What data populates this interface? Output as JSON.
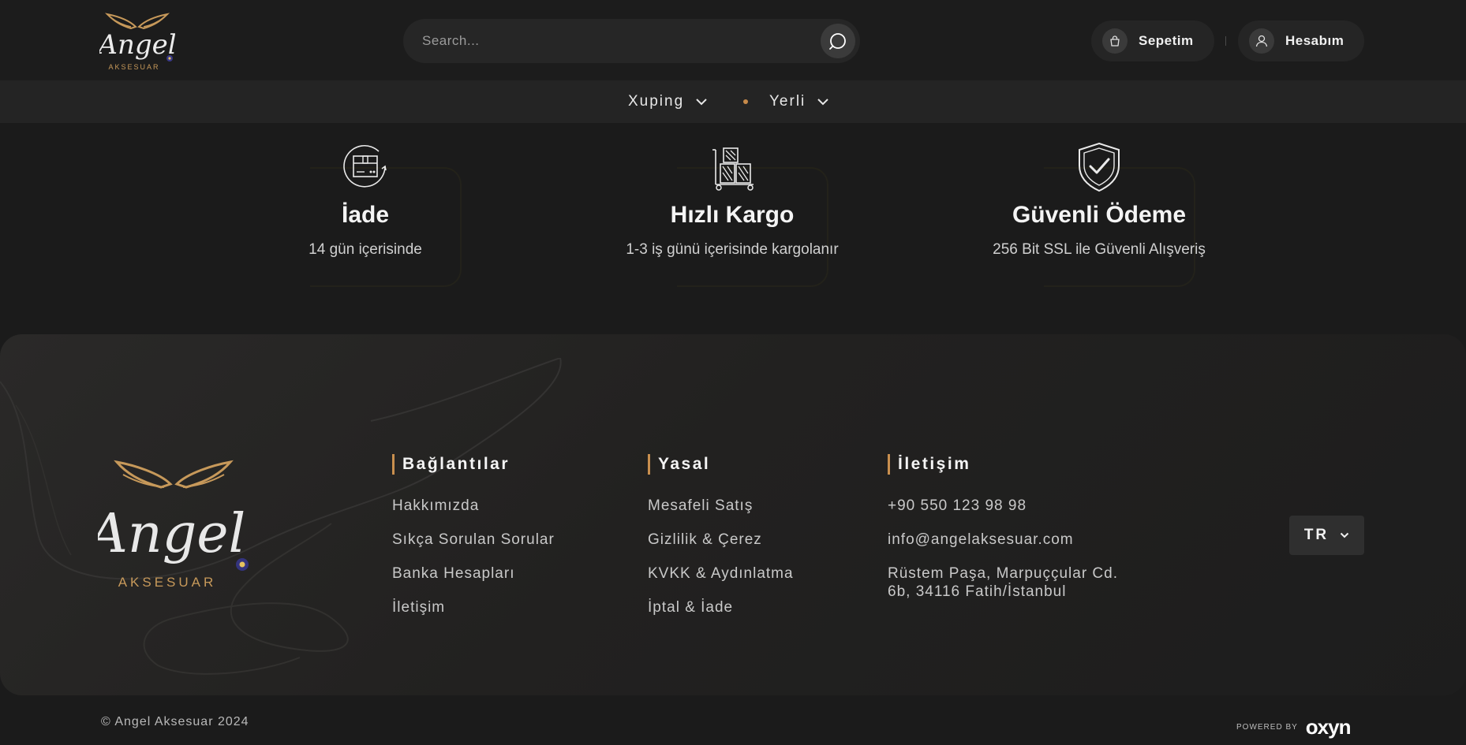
{
  "header": {
    "logo_text": "Angel",
    "logo_sub": "AKSESUAR",
    "search": {
      "placeholder": "Search..."
    },
    "cart_label": "Sepetim",
    "account_label": "Hesabım"
  },
  "nav": {
    "items": [
      {
        "label": "Xuping"
      },
      {
        "label": "Yerli"
      }
    ]
  },
  "features": [
    {
      "icon": "return-box-icon",
      "title": "İade",
      "subtitle": "14 gün içerisinde"
    },
    {
      "icon": "cargo-boxes-icon",
      "title": "Hızlı Kargo",
      "subtitle": "1-3 iş günü içerisinde kargolanır"
    },
    {
      "icon": "shield-check-icon",
      "title": "Güvenli Ödeme",
      "subtitle": "256 Bit SSL ile Güvenli Alışveriş"
    }
  ],
  "footer": {
    "logo_text": "Angel",
    "logo_sub": "AKSESUAR",
    "columns": [
      {
        "title": "Bağlantılar",
        "links": [
          "Hakkımızda",
          "Sıkça Sorulan Sorular",
          "Banka Hesapları",
          "İletişim"
        ]
      },
      {
        "title": "Yasal",
        "links": [
          "Mesafeli Satış",
          "Gizlilik & Çerez",
          "KVKK & Aydınlatma",
          "İptal & İade"
        ]
      },
      {
        "title": "İletişim",
        "links": [
          "+90 550 123 98 98",
          "info@angelaksesuar.com",
          "Rüstem Paşa, Marpuççular Cd.",
          "6b, 34116 Fatih/İstanbul"
        ]
      }
    ],
    "language": "TR",
    "copyright": "© Angel Aksesuar 2024",
    "powered_by": "POWERED BY",
    "powered_brand": "oxyn"
  },
  "colors": {
    "accent": "#c98f4e",
    "background": "#1b1b1b",
    "footer_bg": "#242322"
  }
}
